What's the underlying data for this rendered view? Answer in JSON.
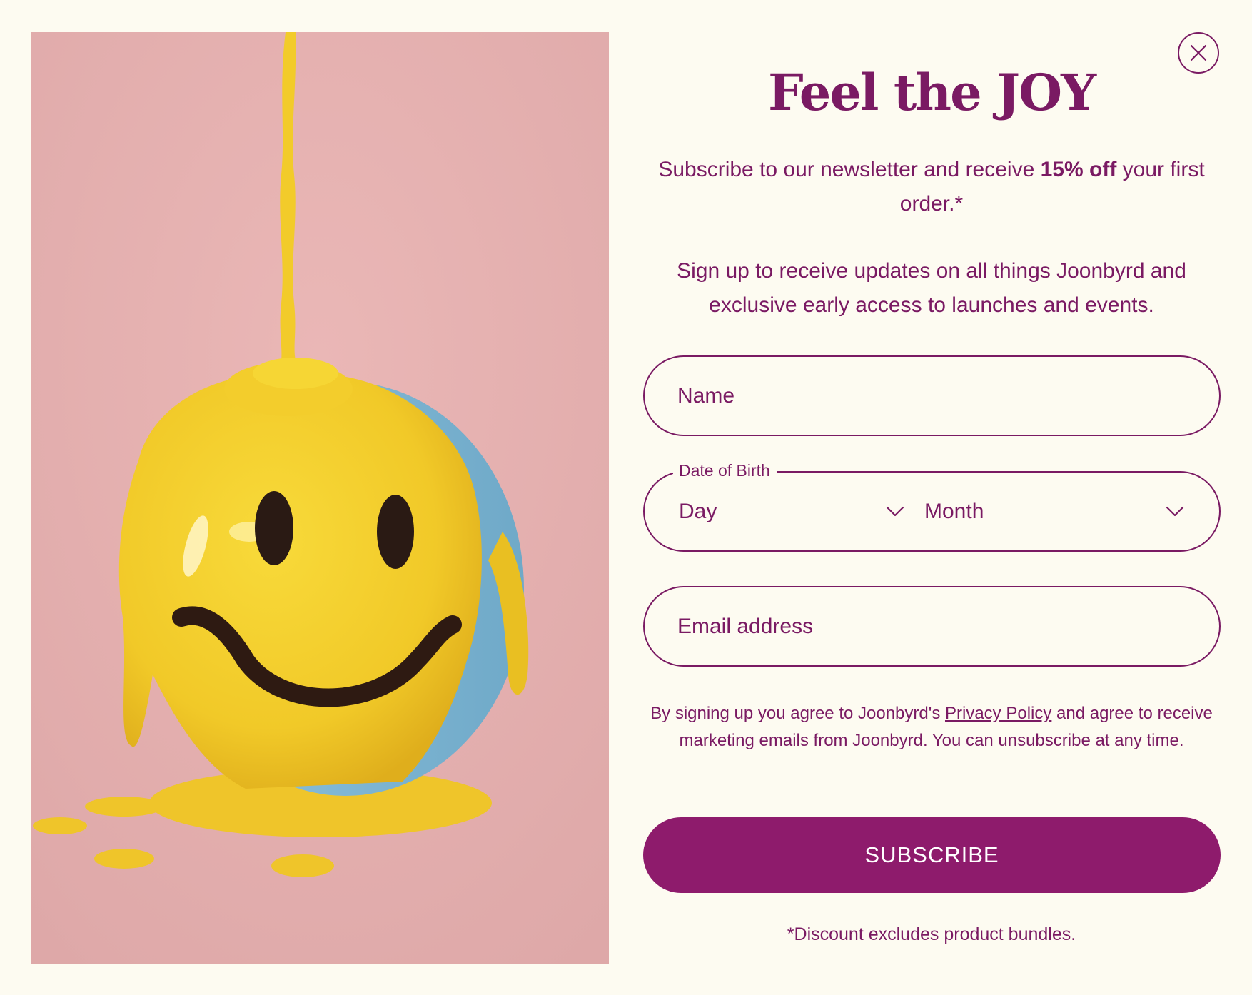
{
  "modal": {
    "title": "Feel the JOY",
    "lead_before": "Subscribe to our newsletter and receive ",
    "lead_bold": "15% off",
    "lead_after": " your first order.*",
    "sub": "Sign up to receive updates on all things Joonbyrd and exclusive early access to launches and events.",
    "close_icon": "close-icon"
  },
  "form": {
    "name_placeholder": "Name",
    "dob_label": "Date of Birth",
    "day_value": "Day",
    "month_value": "Month",
    "email_placeholder": "Email address",
    "legal_before": "By signing up you agree to Joonbyrd's ",
    "legal_link": "Privacy Policy",
    "legal_after": " and agree to receive marketing emails from Joonbyrd. You can unsubscribe at any time.",
    "subscribe_label": "SUBSCRIBE",
    "footnote": "*Discount excludes product bundles."
  },
  "colors": {
    "brand": "#8e1b6c",
    "text": "#7a1a63",
    "background": "#fdfbf1",
    "hero_bg": "#e8b3b3",
    "glaze": "#f3cf2a"
  }
}
